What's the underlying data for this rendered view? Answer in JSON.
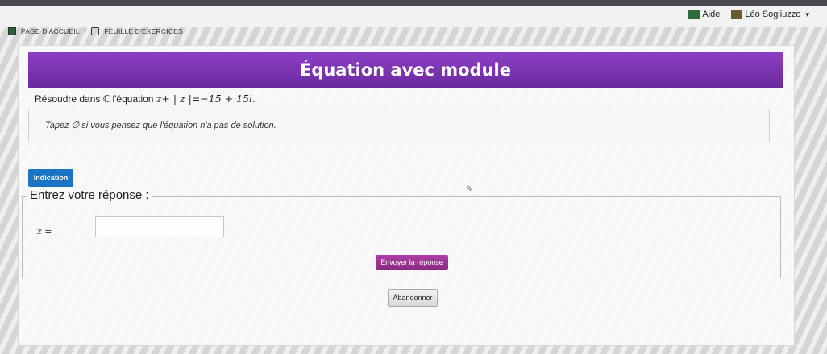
{
  "topbar": {
    "help_label": "Aide",
    "help_icon": "help-icon",
    "user_label": "Léo Sogliuzzo",
    "user_icon": "user-avatar-icon",
    "user_caret": "▾"
  },
  "breadcrumb": {
    "items": [
      "PAGE D'ACCUEIL",
      "FEUILLE D'EXERCICES"
    ],
    "separator": "/"
  },
  "exercise": {
    "title": "Équation avec module",
    "title_bar_color": "#7a33b0",
    "question_prefix": "Résoudre dans",
    "question_set": "ℂ",
    "question_mid": "l'équation",
    "question_equation": "z+ | z |=−15 + 15i.",
    "hint": "Tapez  ∅  si vous pensez que l'équation n'a pas de solution.",
    "indication_button": "Indication",
    "indication_color": "#1a73c4"
  },
  "answer": {
    "legend": "Entrez votre réponse :",
    "z_label": "z =",
    "z_value": "",
    "submit_label": "Envoyer la réponse",
    "submit_color": "#9e3596"
  },
  "footer": {
    "abandon_label": "Abandonner"
  }
}
